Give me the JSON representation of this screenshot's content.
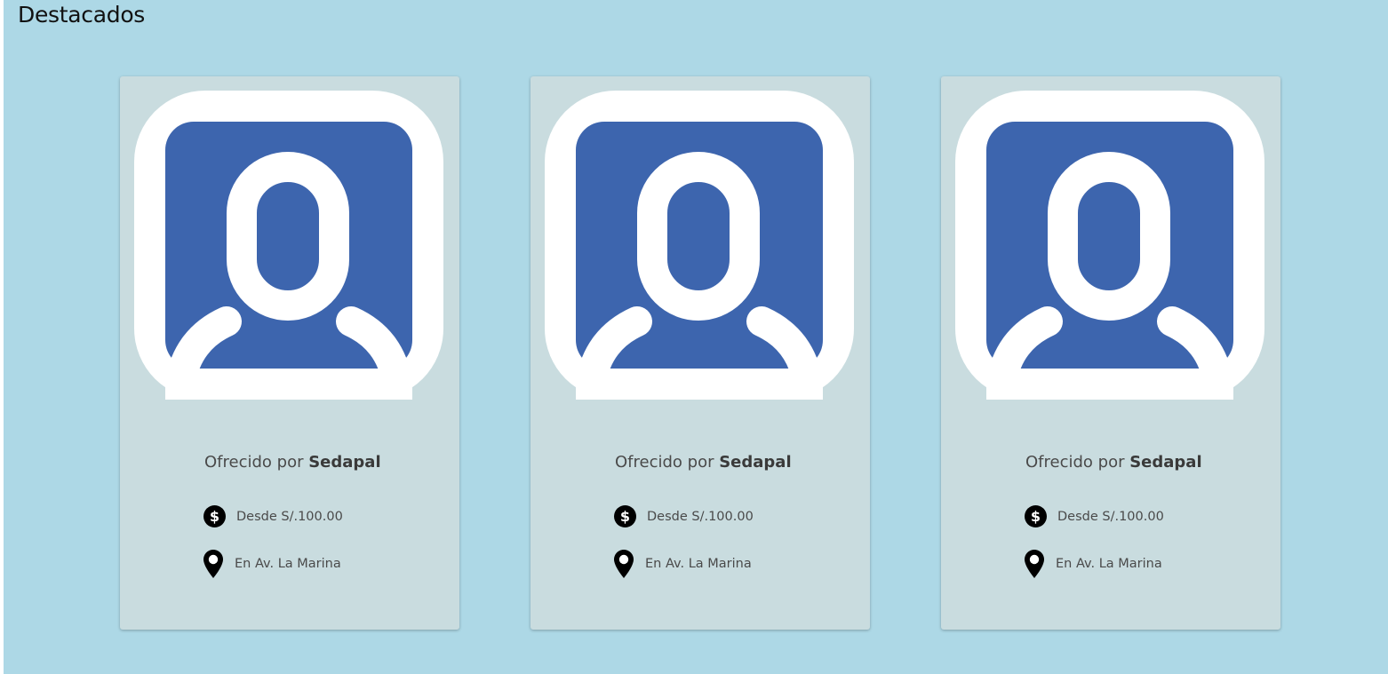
{
  "section": {
    "title": "Destacados"
  },
  "colors": {
    "background": "#add8e6",
    "card": "#c9dcdf",
    "avatar_blue": "#3d65ae"
  },
  "cards": [
    {
      "icon": "user-avatar-icon",
      "offer_prefix": "Ofrecido por",
      "provider": "Sedapal",
      "price": "Desde S/.100.00",
      "location": "En Av. La Marina"
    },
    {
      "icon": "user-avatar-icon",
      "offer_prefix": "Ofrecido por",
      "provider": "Sedapal",
      "price": "Desde S/.100.00",
      "location": "En Av. La Marina"
    },
    {
      "icon": "user-avatar-icon",
      "offer_prefix": "Ofrecido por",
      "provider": "Sedapal",
      "price": "Desde S/.100.00",
      "location": "En Av. La Marina"
    }
  ]
}
